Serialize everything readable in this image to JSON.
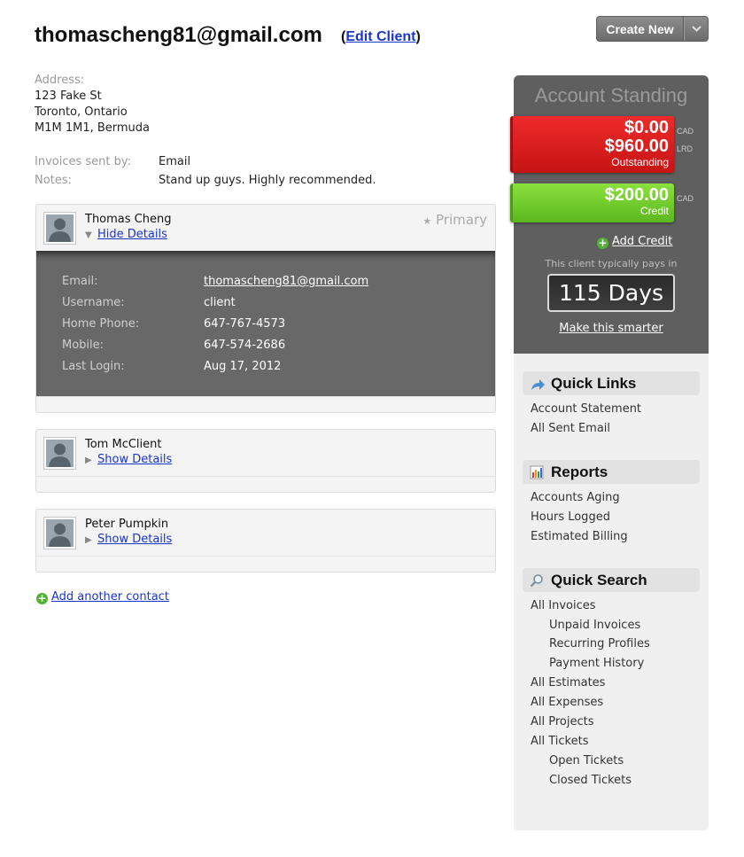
{
  "header": {
    "client_email": "thomascheng81@gmail.com",
    "edit_client_label": "Edit Client",
    "create_new_label": "Create New"
  },
  "address": {
    "label": "Address:",
    "line1": "123 Fake St",
    "line2": "Toronto, Ontario",
    "line3": "M1M 1M1, Bermuda"
  },
  "info": {
    "invoices_sent_by_label": "Invoices sent by:",
    "invoices_sent_by_value": "Email",
    "notes_label": "Notes:",
    "notes_value": "Stand up guys. Highly recommended."
  },
  "contacts": [
    {
      "name": "Thomas Cheng",
      "toggle_label": "Hide Details",
      "primary_label": "Primary",
      "details": {
        "email_label": "Email:",
        "email_value": "thomascheng81@gmail.com",
        "username_label": "Username:",
        "username_value": "client",
        "home_phone_label": "Home Phone:",
        "home_phone_value": "647-767-4573",
        "mobile_label": "Mobile:",
        "mobile_value": "647-574-2686",
        "last_login_label": "Last Login:",
        "last_login_value": "Aug 17, 2012"
      }
    },
    {
      "name": "Tom McClient",
      "toggle_label": "Show Details"
    },
    {
      "name": "Peter Pumpkin",
      "toggle_label": "Show Details"
    }
  ],
  "add_contact_label": "Add another contact",
  "standing": {
    "title": "Account Standing",
    "outstanding_cad": "$0.00",
    "outstanding_lrd": "$960.00",
    "outstanding_label": "Outstanding",
    "credit_amount": "$200.00",
    "credit_label": "Credit",
    "currency_cad": "CAD",
    "currency_lrd": "LRD",
    "add_credit_label": "Add Credit",
    "pays_in_text": "This client typically pays in",
    "days": "115 Days",
    "make_smarter_label": "Make this smarter"
  },
  "quick_links": {
    "title": "Quick Links",
    "items": [
      "Account Statement",
      "All Sent Email"
    ]
  },
  "reports": {
    "title": "Reports",
    "items": [
      "Accounts Aging",
      "Hours Logged",
      "Estimated Billing"
    ]
  },
  "quick_search": {
    "title": "Quick Search",
    "items": [
      "All Invoices",
      "Unpaid Invoices",
      "Recurring Profiles",
      "Payment History",
      "All Estimates",
      "All Expenses",
      "All Projects",
      "All Tickets",
      "Open Tickets",
      "Closed Tickets"
    ]
  },
  "colors": {
    "outstanding": "#d81c1c",
    "credit": "#6cc72a",
    "link": "#1a35c9",
    "panel": "#5f5f5f"
  }
}
